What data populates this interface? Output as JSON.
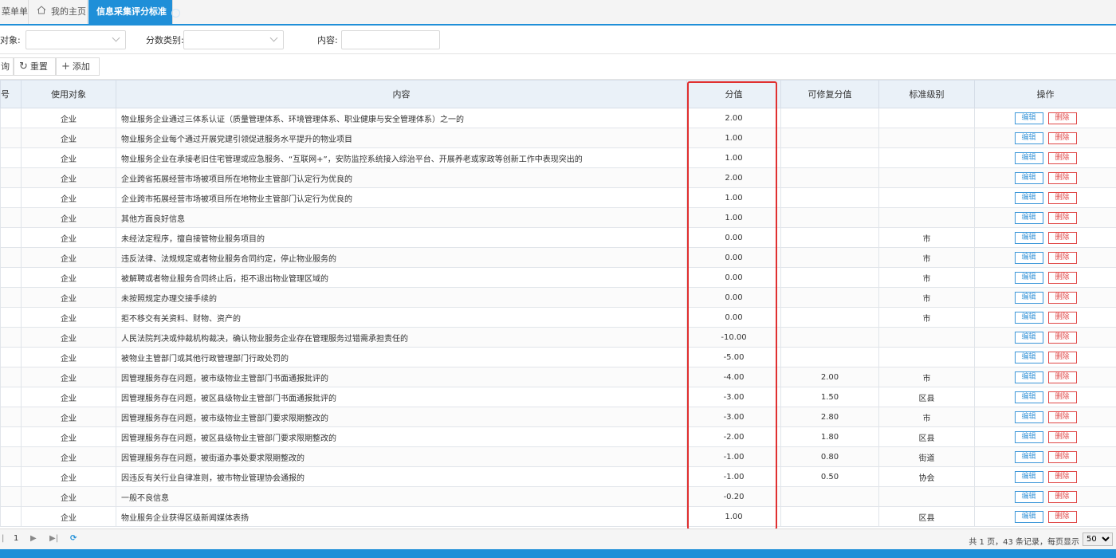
{
  "tabs": {
    "menu": "菜单单",
    "home": "我的主页",
    "current": "信息采集评分标准"
  },
  "search": {
    "target_label": "对象:",
    "category_label": "分数类别:",
    "content_label": "内容:",
    "target_value": "",
    "category_value": "",
    "content_value": ""
  },
  "toolbar": {
    "query": "询",
    "reset": "重置",
    "add": "添加"
  },
  "table": {
    "columns": {
      "index": "号",
      "target": "使用对象",
      "content": "内容",
      "score": "分值",
      "repairable": "可修复分值",
      "level": "标准级别",
      "actions": "操作"
    },
    "edit_label": "编辑",
    "delete_label": "删除",
    "rows": [
      {
        "target": "企业",
        "content": "物业服务企业通过三体系认证（质量管理体系、环境管理体系、职业健康与安全管理体系）之一的",
        "score": "2.00",
        "repair": "",
        "level": ""
      },
      {
        "target": "企业",
        "content": "物业服务企业每个通过开展党建引领促进服务水平提升的物业项目",
        "score": "1.00",
        "repair": "",
        "level": ""
      },
      {
        "target": "企业",
        "content": "物业服务企业在承接老旧住宅管理或应急服务、“互联网+”，安防监控系统接入综治平台、开展养老或家政等创新工作中表现突出的",
        "score": "1.00",
        "repair": "",
        "level": ""
      },
      {
        "target": "企业",
        "content": "企业跨省拓展经营市场被项目所在地物业主管部门认定行为优良的",
        "score": "2.00",
        "repair": "",
        "level": ""
      },
      {
        "target": "企业",
        "content": "企业跨市拓展经营市场被项目所在地物业主管部门认定行为优良的",
        "score": "1.00",
        "repair": "",
        "level": ""
      },
      {
        "target": "企业",
        "content": "其他方面良好信息",
        "score": "1.00",
        "repair": "",
        "level": ""
      },
      {
        "target": "企业",
        "content": "未经法定程序，擅自接管物业服务项目的",
        "score": "0.00",
        "repair": "",
        "level": "市"
      },
      {
        "target": "企业",
        "content": "违反法律、法规规定或者物业服务合同约定，停止物业服务的",
        "score": "0.00",
        "repair": "",
        "level": "市"
      },
      {
        "target": "企业",
        "content": "被解聘或者物业服务合同终止后，拒不退出物业管理区域的",
        "score": "0.00",
        "repair": "",
        "level": "市"
      },
      {
        "target": "企业",
        "content": "未按照规定办理交接手续的",
        "score": "0.00",
        "repair": "",
        "level": "市"
      },
      {
        "target": "企业",
        "content": "拒不移交有关资料、财物、资产的",
        "score": "0.00",
        "repair": "",
        "level": "市"
      },
      {
        "target": "企业",
        "content": "人民法院判决或仲裁机构裁决，确认物业服务企业存在管理服务过错需承担责任的",
        "score": "-10.00",
        "repair": "",
        "level": ""
      },
      {
        "target": "企业",
        "content": "被物业主管部门或其他行政管理部门行政处罚的",
        "score": "-5.00",
        "repair": "",
        "level": ""
      },
      {
        "target": "企业",
        "content": "因管理服务存在问题，被市级物业主管部门书面通报批评的",
        "score": "-4.00",
        "repair": "2.00",
        "level": "市"
      },
      {
        "target": "企业",
        "content": "因管理服务存在问题，被区县级物业主管部门书面通报批评的",
        "score": "-3.00",
        "repair": "1.50",
        "level": "区县"
      },
      {
        "target": "企业",
        "content": "因管理服务存在问题，被市级物业主管部门要求限期整改的",
        "score": "-3.00",
        "repair": "2.80",
        "level": "市"
      },
      {
        "target": "企业",
        "content": "因管理服务存在问题，被区县级物业主管部门要求限期整改的",
        "score": "-2.00",
        "repair": "1.80",
        "level": "区县"
      },
      {
        "target": "企业",
        "content": "因管理服务存在问题，被街道办事处要求限期整改的",
        "score": "-1.00",
        "repair": "0.80",
        "level": "街道"
      },
      {
        "target": "企业",
        "content": "因违反有关行业自律准则，被市物业管理协会通报的",
        "score": "-1.00",
        "repair": "0.50",
        "level": "协会"
      },
      {
        "target": "企业",
        "content": "一般不良信息",
        "score": "-0.20",
        "repair": "",
        "level": ""
      },
      {
        "target": "企业",
        "content": "物业服务企业获得区级新闻媒体表扬",
        "score": "1.00",
        "repair": "",
        "level": "区县"
      }
    ]
  },
  "pager": {
    "current_page": "1",
    "info": "共 1 页，43 条记录，每页显示",
    "page_size": "50"
  },
  "colors": {
    "accent": "#1f8fd8",
    "highlight": "#e03030",
    "header_bg": "#eaf1f8",
    "edit": "#3c97d9",
    "delete": "#e04848"
  }
}
